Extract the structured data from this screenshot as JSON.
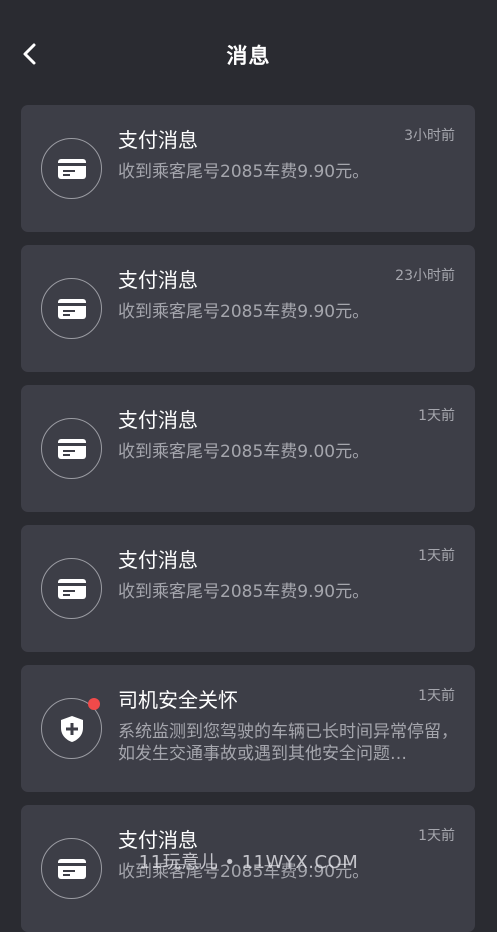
{
  "header": {
    "title": "消息",
    "back_icon": "chevron-left-icon"
  },
  "messages": [
    {
      "title": "支付消息",
      "time": "3小时前",
      "body": "收到乘客尾号2085车费9.90元。",
      "icon": "card-icon",
      "unread": false
    },
    {
      "title": "支付消息",
      "time": "23小时前",
      "body": "收到乘客尾号2085车费9.90元。",
      "icon": "card-icon",
      "unread": false
    },
    {
      "title": "支付消息",
      "time": "1天前",
      "body": "收到乘客尾号2085车费9.00元。",
      "icon": "card-icon",
      "unread": false
    },
    {
      "title": "支付消息",
      "time": "1天前",
      "body": "收到乘客尾号2085车费9.90元。",
      "icon": "card-icon",
      "unread": false
    },
    {
      "title": "司机安全关怀",
      "time": "1天前",
      "body": "系统监测到您驾驶的车辆已长时间异常停留，如发生交通事故或遇到其他安全问题…",
      "icon": "shield-plus-icon",
      "unread": true
    },
    {
      "title": "支付消息",
      "time": "1天前",
      "body": "收到乘客尾号2085车费9.90元。",
      "icon": "card-icon",
      "unread": false
    }
  ],
  "watermark": "11玩意儿 • 11WYX.COM",
  "colors": {
    "background": "#2a2b31",
    "card": "#3d3e47",
    "unread_dot": "#f04a4a"
  }
}
